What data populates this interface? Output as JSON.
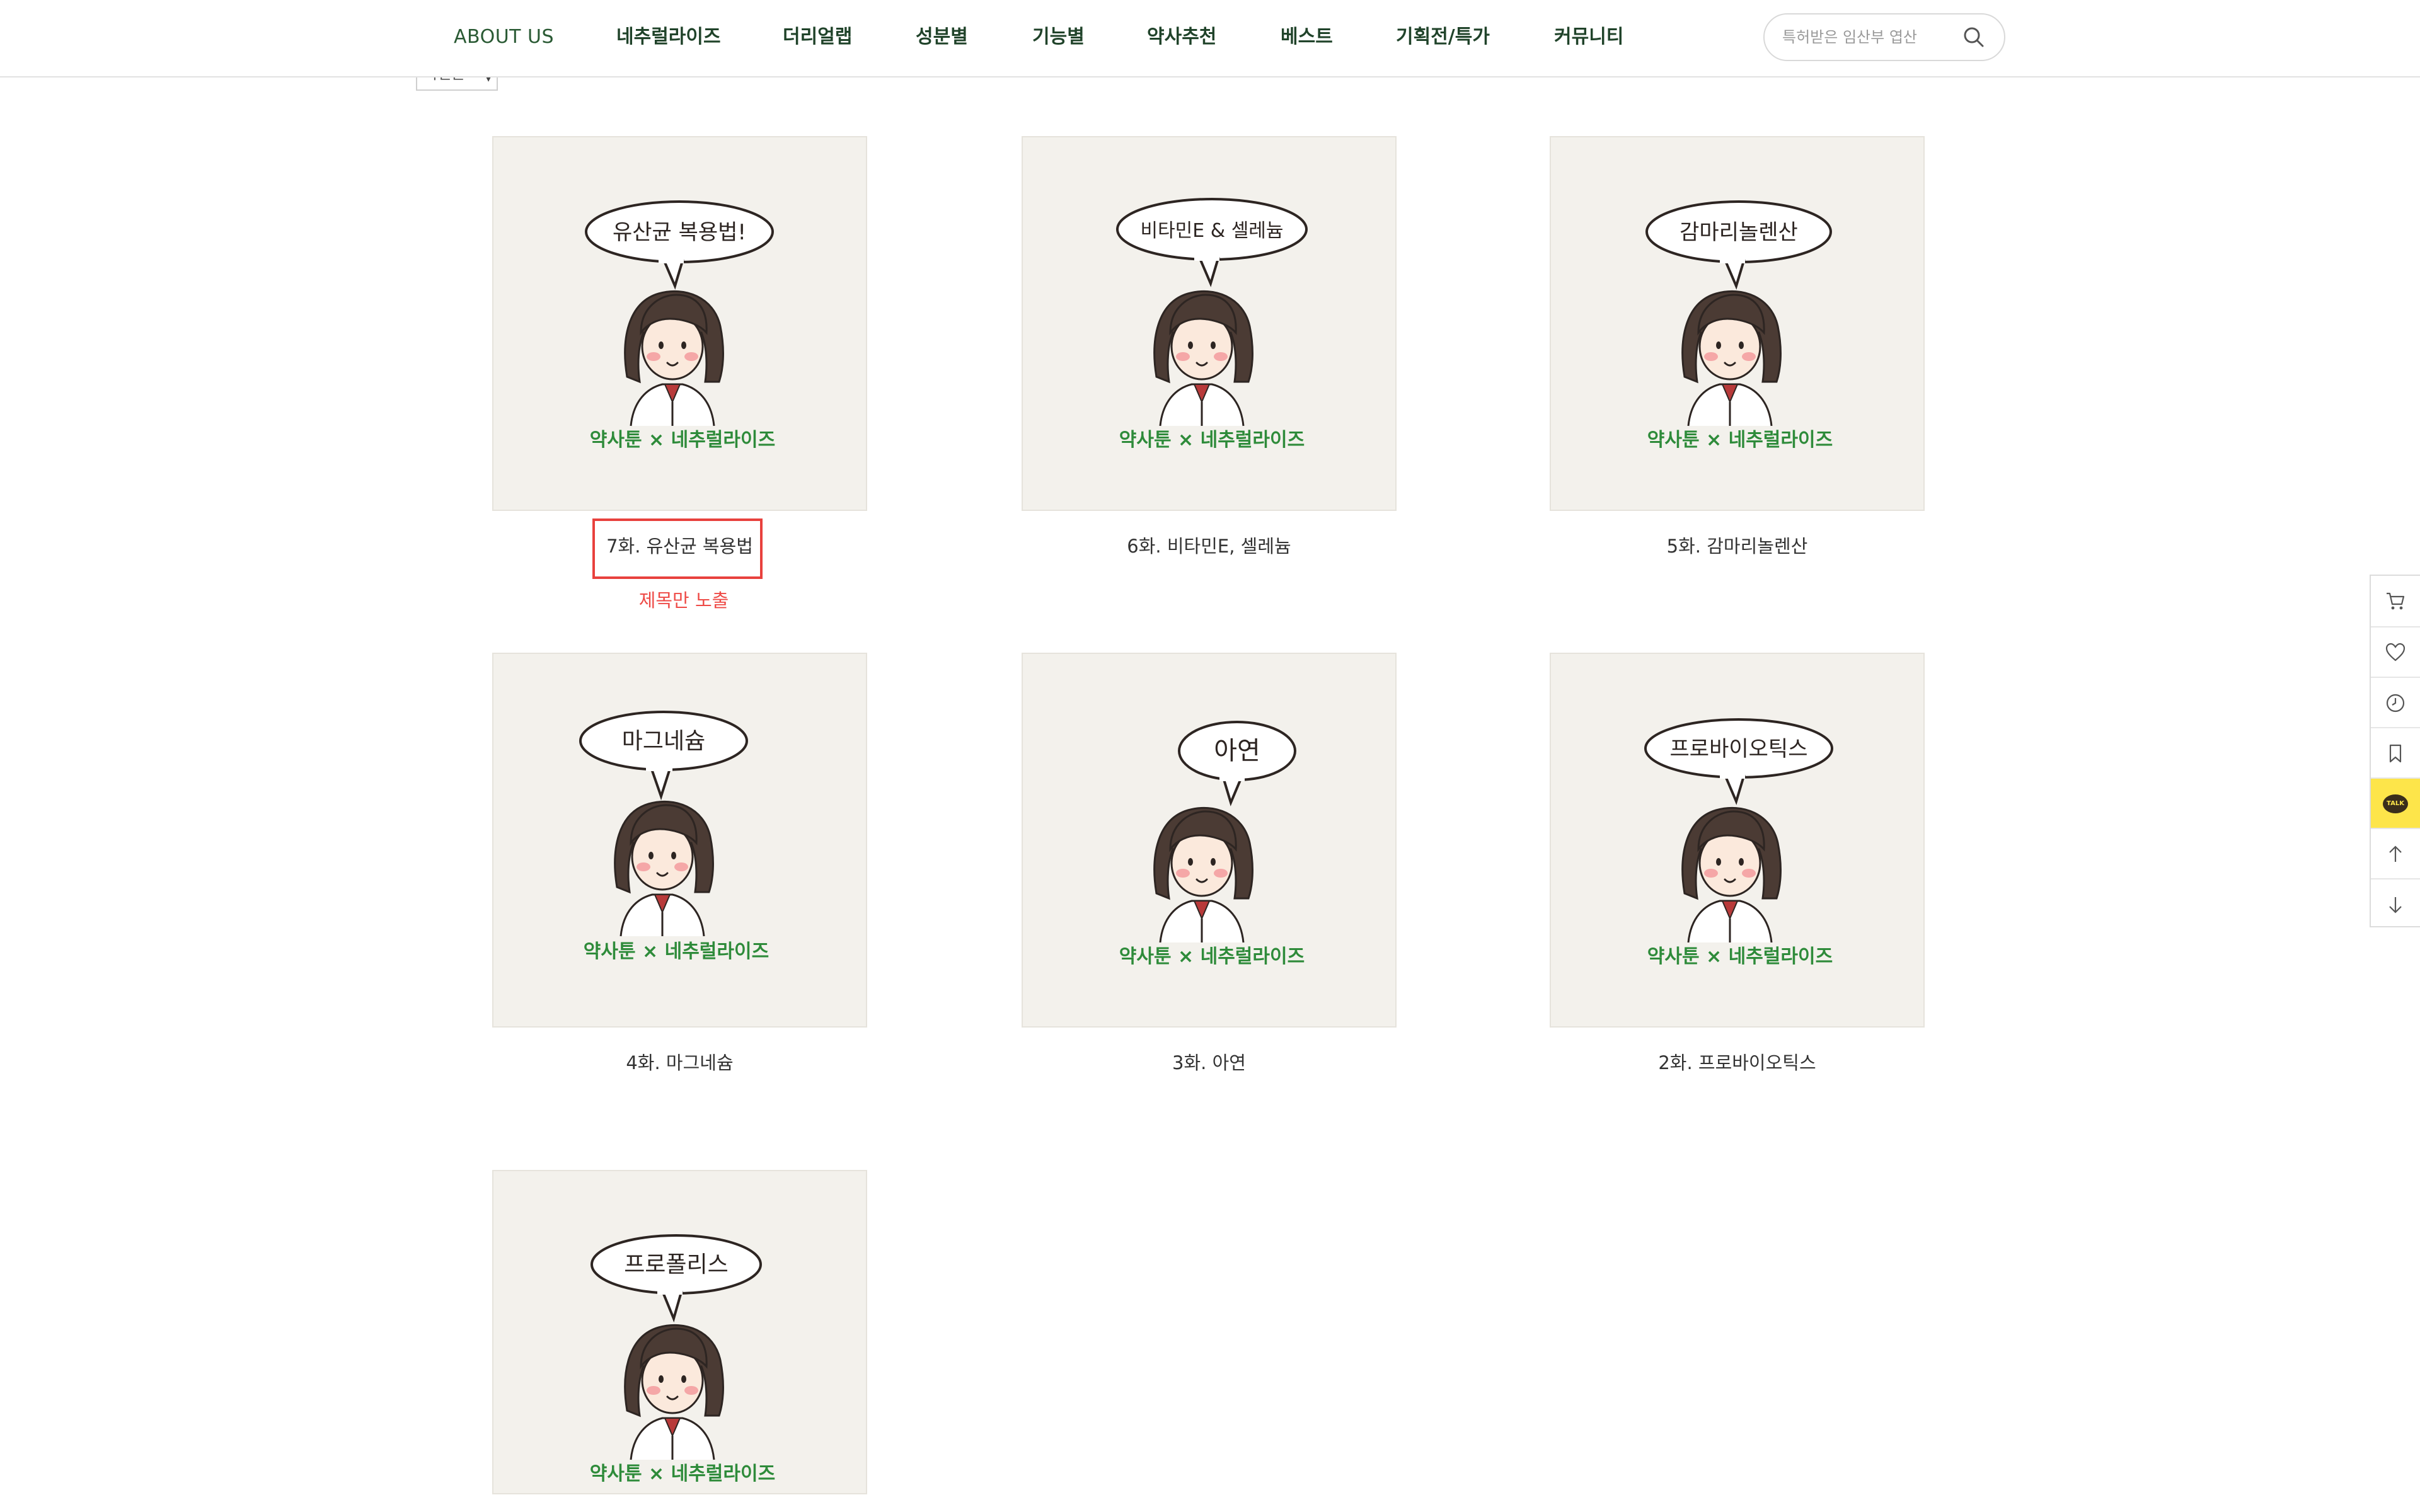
{
  "nav": {
    "items": [
      "ABOUT US",
      "네추럴라이즈",
      "더리얼랩",
      "성분별",
      "기능별",
      "약사추천",
      "베스트",
      "기획전/특가",
      "커뮤니티"
    ]
  },
  "search": {
    "placeholder": "특허받은 임산부 엽산"
  },
  "sort": {
    "selected": "최신순"
  },
  "cards": [
    {
      "title": "7화. 유산균 복용법",
      "bubble": "유산균 복용법!",
      "caption": "약사툰 × 네추럴라이즈"
    },
    {
      "title": "6화. 비타민E, 셀레늄",
      "bubble": "비타민E & 셀레늄",
      "caption": "약사툰 × 네추럴라이즈"
    },
    {
      "title": "5화. 감마리놀렌산",
      "bubble": "감마리놀렌산",
      "caption": "약사툰 × 네추럴라이즈"
    },
    {
      "title": "4화. 마그네슘",
      "bubble": "마그네슘",
      "caption": "약사툰 × 네추럴라이즈"
    },
    {
      "title": "3화. 아연",
      "bubble": "아연",
      "caption": "약사툰 × 네추럴라이즈"
    },
    {
      "title": "2화. 프로바이오틱스",
      "bubble": "프로바이오틱스",
      "caption": "약사툰 × 네추럴라이즈"
    },
    {
      "title": "",
      "bubble": "프로폴리스",
      "caption": "약사툰 × 네추럴라이즈"
    }
  ],
  "annotation": {
    "note": "제목만 노출"
  },
  "quickbar": {
    "icons": [
      "cart-icon",
      "heart-icon",
      "clock-icon",
      "bookmark-icon",
      "kakao-talk-icon",
      "arrow-up-icon",
      "arrow-down-icon"
    ],
    "talk_label": "TALK",
    "talk_color": "#fde54a"
  },
  "colors": {
    "nav_text": "#1f4a2a",
    "caption_green": "#2e8b3a",
    "annotation_red": "#e8413d"
  }
}
